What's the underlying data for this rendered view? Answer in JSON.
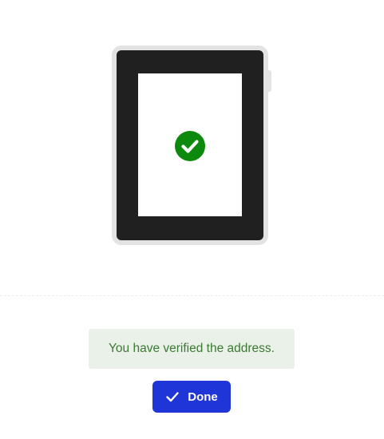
{
  "device": {
    "screen_icon": "check-circle-icon",
    "frame_color": "#e3e3e3",
    "body_color": "#202020",
    "screen_color": "#ffffff",
    "check_color": "#0d8a0d"
  },
  "status": {
    "message": "You have verified the address.",
    "background_color": "#e9f1e8",
    "text_color": "#3b7a32"
  },
  "actions": {
    "done_label": "Done",
    "done_icon": "checkmark-icon",
    "done_color": "#2035d8"
  }
}
